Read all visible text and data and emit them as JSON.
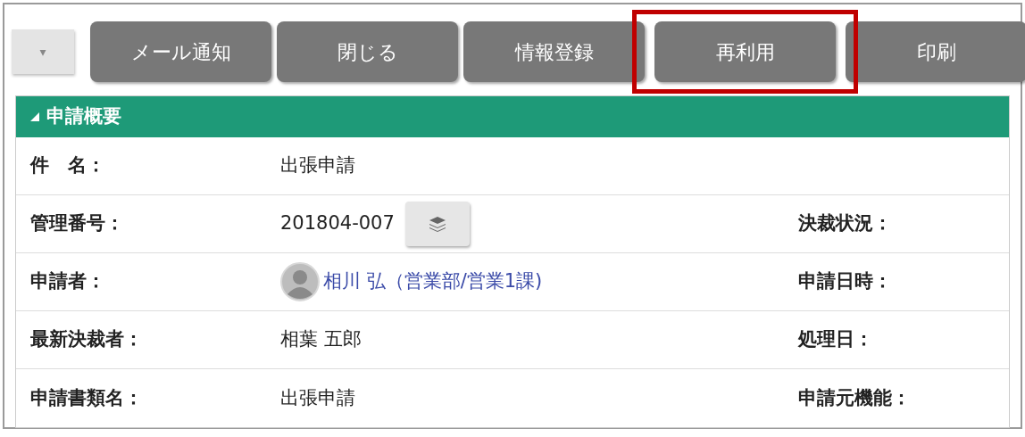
{
  "toolbar": {
    "menu_button": {
      "label": "▾"
    },
    "buttons": [
      {
        "label": "メール通知",
        "highlighted": false
      },
      {
        "label": "閉じる",
        "highlighted": false
      },
      {
        "label": "情報登録",
        "highlighted": false
      },
      {
        "label": "再利用",
        "highlighted": true
      },
      {
        "label": "印刷",
        "highlighted": false
      }
    ]
  },
  "panel": {
    "title": "申請概要",
    "expanded": true,
    "rows": [
      {
        "label": "件　名：",
        "kind": "text",
        "value": "出張申請"
      },
      {
        "label": "管理番号：",
        "kind": "copy",
        "value": "201804-007",
        "right_label": "決裁状況："
      },
      {
        "label": "申請者：",
        "kind": "user",
        "value": "相川 弘（営業部/営業1課)",
        "right_label": "申請日時："
      },
      {
        "label": "最新決裁者：",
        "kind": "text",
        "value": "相葉 五郎",
        "right_label": "処理日："
      },
      {
        "label": "申請書類名：",
        "kind": "text",
        "value": "出張申請",
        "right_label": "申請元機能："
      }
    ]
  }
}
